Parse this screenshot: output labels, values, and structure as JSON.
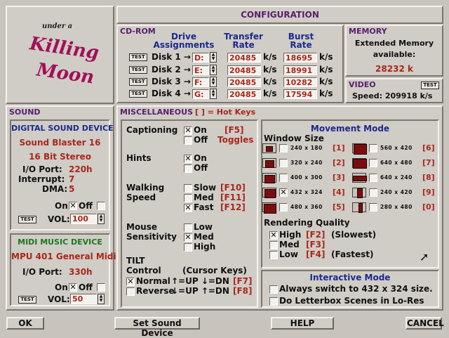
{
  "title": "CONFIGURATION",
  "logo": {
    "line1": "under a",
    "line2": "Killing",
    "line3": "Moon"
  },
  "cdrom": {
    "header": "CD-ROM",
    "col_drive": "Drive Assignments",
    "col_transfer": "Transfer Rate",
    "col_burst": "Burst Rate",
    "test_label": "TEST",
    "unit": "k/s",
    "disks": [
      {
        "label": "Disk 1 →",
        "drive": "D:",
        "transfer": "20485",
        "burst": "18695"
      },
      {
        "label": "Disk 2 →",
        "drive": "E:",
        "transfer": "20485",
        "burst": "18991"
      },
      {
        "label": "Disk 3 →",
        "drive": "F:",
        "transfer": "20485",
        "burst": "10282"
      },
      {
        "label": "Disk 4 →",
        "drive": "G:",
        "transfer": "20485",
        "burst": "17594"
      }
    ]
  },
  "memory": {
    "header": "MEMORY",
    "text1": "Extended Memory",
    "text2": "available:",
    "value": "28232 k"
  },
  "video": {
    "header": "VIDEO",
    "test_label": "TEST",
    "speed": "Speed: 209918 k/s"
  },
  "sound": {
    "header": "SOUND",
    "digital": {
      "header": "DIGITAL SOUND DEVICE",
      "device": "Sound Blaster 16",
      "mode": "16 Bit Stereo",
      "io_label": "I/O Port:",
      "io_value": "220h",
      "irq_label": "Interrupt:",
      "irq_value": "7",
      "dma_label": "DMA:",
      "dma_value": "5",
      "on_label": "On",
      "off_label": "Off",
      "test_label": "TEST",
      "vol_label": "VOL:",
      "vol_value": "100"
    },
    "midi": {
      "header": "MIDI MUSIC DEVICE",
      "device": "MPU 401 General Midi",
      "io_label": "I/O Port:",
      "io_value": "330h",
      "on_label": "On",
      "off_label": "Off",
      "test_label": "TEST",
      "vol_label": "VOL:",
      "vol_value": "50"
    }
  },
  "misc": {
    "header": "MISCELLANEOUS",
    "hotkeys": "[ ] = Hot Keys",
    "captioning": {
      "label": "Captioning",
      "on": "On",
      "on_key": "[F5]",
      "off": "Off",
      "toggles": "Toggles"
    },
    "hints": {
      "label": "Hints",
      "on": "On",
      "off": "Off"
    },
    "walking": {
      "label1": "Walking",
      "label2": "Speed",
      "slow": "Slow",
      "slow_key": "[F10]",
      "med": "Med",
      "med_key": "[F11]",
      "fast": "Fast",
      "fast_key": "[F12]"
    },
    "mouse": {
      "label1": "Mouse",
      "label2": "Sensitivity",
      "low": "Low",
      "med": "Med",
      "high": "High"
    },
    "tilt": {
      "label1": "TILT",
      "label2": "Control",
      "cursor": "(Cursor Keys)",
      "normal": "Normal",
      "normal_desc": "↑=UP ↓=DN",
      "normal_key": "[F7]",
      "reverse": "Reverse",
      "reverse_desc": "↓=UP ↑=DN",
      "reverse_key": "[F8]"
    }
  },
  "movement": {
    "header": "Movement Mode",
    "window_size": "Window Size",
    "sizes": [
      {
        "label": "240 x 180",
        "key": "[1]"
      },
      {
        "label": "320 x 240",
        "key": "[2]"
      },
      {
        "label": "400 x 300",
        "key": "[3]"
      },
      {
        "label": "432 x 324",
        "key": "[4]"
      },
      {
        "label": "480 x 360",
        "key": "[5]"
      },
      {
        "label": "560 x 420",
        "key": "[6]"
      },
      {
        "label": "640 x 480",
        "key": "[7]"
      },
      {
        "label": "640 x 240",
        "key": "[8]"
      },
      {
        "label": "240 x 420",
        "key": "[9]"
      },
      {
        "label": "280 x 480",
        "key": "[0]"
      }
    ],
    "rendering": "Rendering Quality",
    "high": "High",
    "high_key": "[F2]",
    "high_desc": "(Slowest)",
    "med": "Med",
    "med_key": "[F3]",
    "low": "Low",
    "low_key": "[F4]",
    "low_desc": "(Fastest)"
  },
  "interactive": {
    "header": "Interactive Mode",
    "opt1": "Always switch to 432 x 324 size.",
    "opt2": "Do Letterbox Scenes in Lo-Res"
  },
  "buttons": {
    "ok": "OK",
    "sound": "Set Sound Device",
    "help": "HELP",
    "cancel": "CANCEL"
  }
}
